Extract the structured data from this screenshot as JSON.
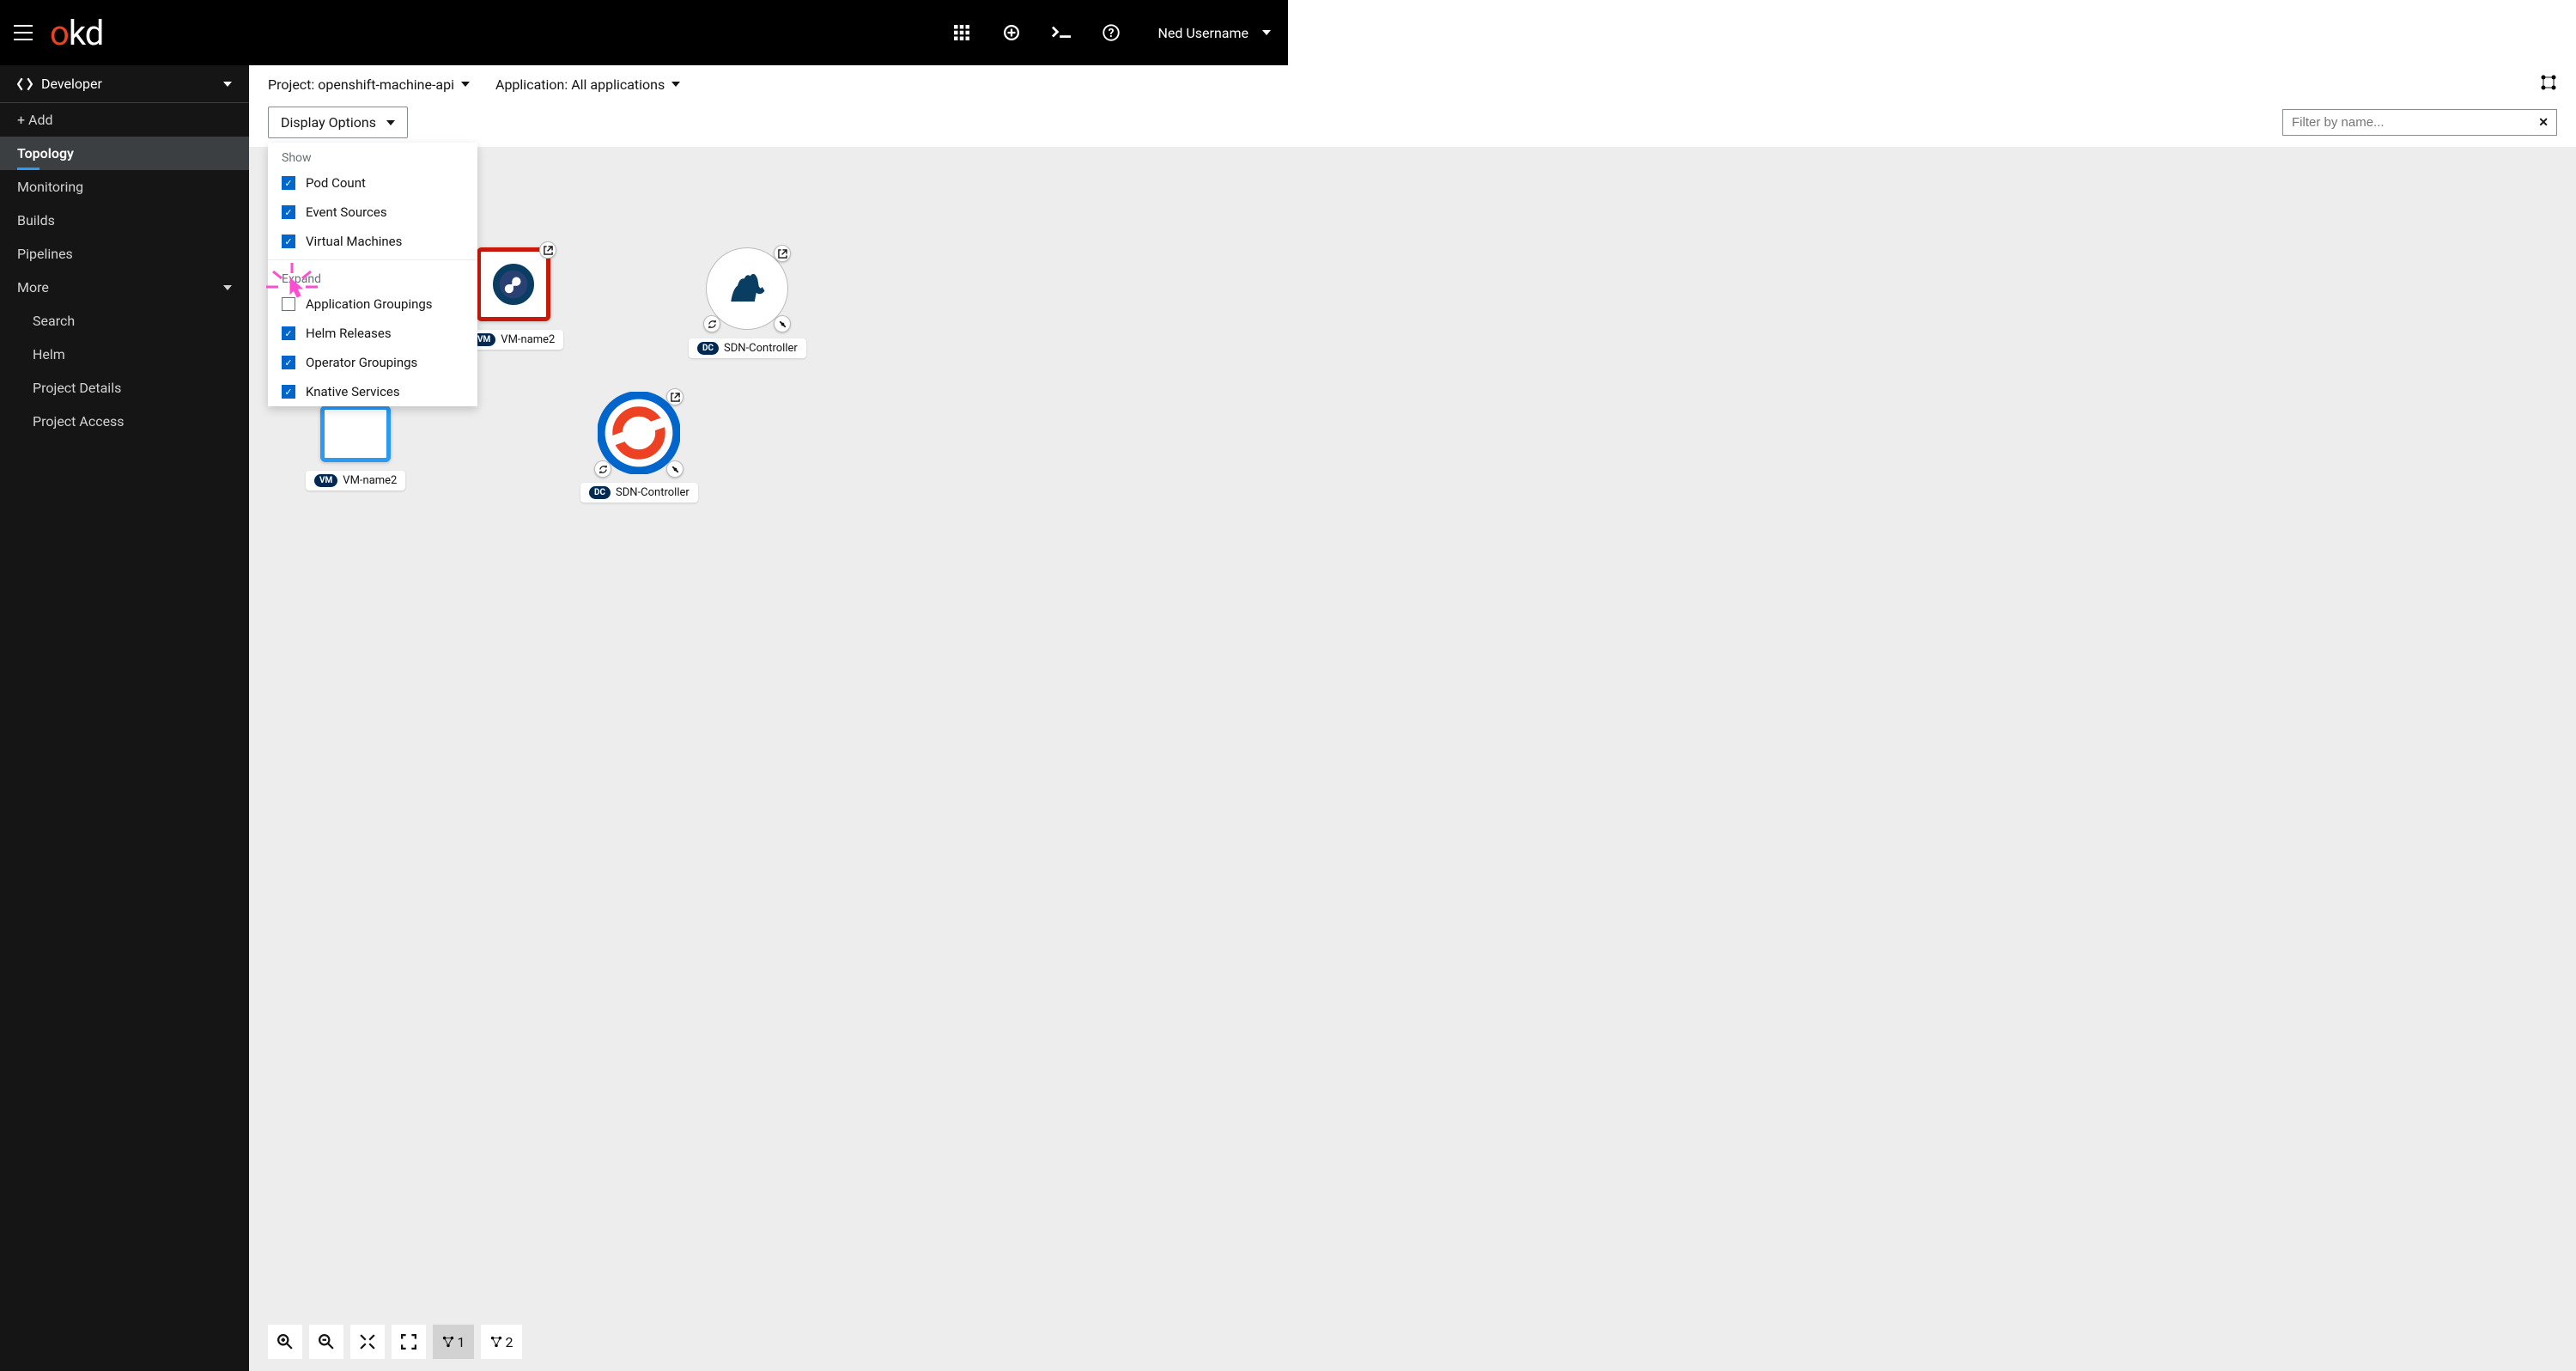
{
  "masthead": {
    "logo_o": "o",
    "logo_kd": "kd",
    "user": "Ned Username"
  },
  "sidebar": {
    "perspective": "Developer",
    "items": [
      {
        "label": "+ Add",
        "active": false
      },
      {
        "label": "Topology",
        "active": true
      },
      {
        "label": "Monitoring",
        "active": false
      },
      {
        "label": "Builds",
        "active": false
      },
      {
        "label": "Pipelines",
        "active": false
      },
      {
        "label": "More",
        "active": false,
        "expandable": true
      }
    ],
    "sub_items": [
      {
        "label": "Search"
      },
      {
        "label": "Helm"
      },
      {
        "label": "Project Details"
      },
      {
        "label": "Project Access"
      }
    ]
  },
  "project_bar": {
    "project_prefix": "Project: ",
    "project": "openshift-machine-api",
    "application_prefix": "Application: ",
    "application": "All applications"
  },
  "filter_bar": {
    "display_options_label": "Display Options",
    "name_filter_placeholder": "Filter by name..."
  },
  "display_options": {
    "show_header": "Show",
    "expand_header": "Expand",
    "show": [
      {
        "label": "Pod Count",
        "checked": true
      },
      {
        "label": "Event Sources",
        "checked": true
      },
      {
        "label": "Virtual Machines",
        "checked": true
      }
    ],
    "expand": [
      {
        "label": "Application Groupings",
        "checked": false
      },
      {
        "label": "Helm Releases",
        "checked": true
      },
      {
        "label": "Operator Groupings",
        "checked": true
      },
      {
        "label": "Knative Services",
        "checked": true
      }
    ]
  },
  "nodes": {
    "vm_off": {
      "badge": "VM",
      "label": "VM-name2"
    },
    "vm_running": {
      "badge": "VM",
      "label": "VM-name2"
    },
    "sdn1": {
      "badge": "DC",
      "label": "SDN-Controller"
    },
    "sdn2": {
      "badge": "DC",
      "label": "SDN-Controller"
    }
  },
  "zoom_bar": {
    "layout1": "1",
    "layout2": "2"
  }
}
